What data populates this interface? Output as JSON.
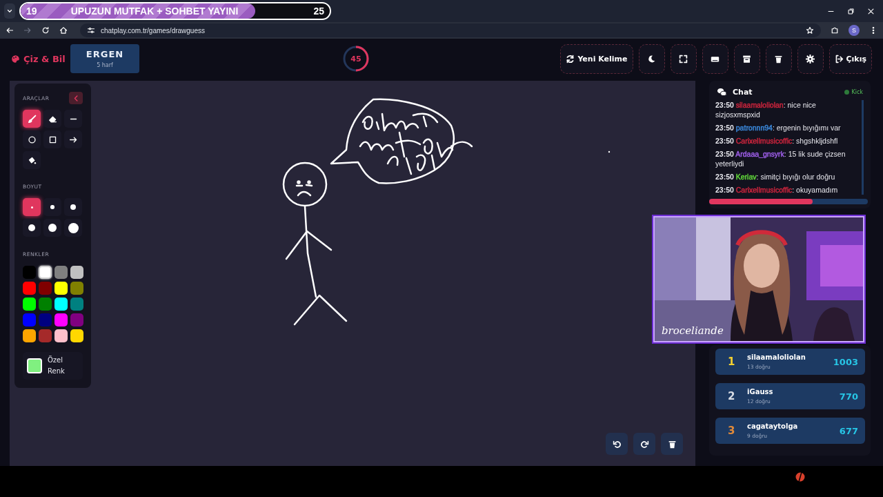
{
  "stream_goal": {
    "start": "19",
    "title": "UPUZUN MUTFAK + SOHBET YAYINI",
    "end": "25",
    "level": 0.76
  },
  "browser": {
    "url": "chatplay.com.tr/games/drawguess",
    "profile_initial": "S"
  },
  "header": {
    "logo": "Çiz & Bil",
    "word": "ERGEN",
    "word_hint": "5 harf",
    "timer": {
      "value": "45",
      "level": 0.5
    },
    "buttons": [
      {
        "kind": "refresh",
        "label": "Yeni Kelime"
      },
      {
        "kind": "moon"
      },
      {
        "kind": "expand"
      },
      {
        "kind": "keyboard"
      },
      {
        "kind": "archive"
      },
      {
        "kind": "trash"
      },
      {
        "kind": "gear"
      },
      {
        "kind": "logout",
        "label": "Çıkış"
      }
    ]
  },
  "tools_panel": {
    "tools_title": "ARAÇLAR",
    "tools": [
      {
        "kind": "brush",
        "selected": true
      },
      {
        "kind": "eraser",
        "selected": false
      },
      {
        "kind": "line",
        "selected": false
      },
      {
        "kind": "circle",
        "selected": false
      },
      {
        "kind": "square",
        "selected": false
      },
      {
        "kind": "arrow",
        "selected": false
      },
      {
        "kind": "fill",
        "selected": false
      }
    ],
    "size_title": "BOYUT",
    "sizes": [
      {
        "selected": true
      },
      {
        "selected": false
      },
      {
        "selected": false
      },
      {
        "selected": false
      },
      {
        "selected": false
      },
      {
        "selected": false
      }
    ],
    "colors_title": "RENKLER",
    "colors": [
      {
        "color": "#000000",
        "selected": false
      },
      {
        "color": "#ffffff",
        "selected": true
      },
      {
        "color": "#808080",
        "selected": false
      },
      {
        "color": "#c0c0c0",
        "selected": false
      },
      {
        "color": "#ff0000",
        "selected": false
      },
      {
        "color": "#800000",
        "selected": false
      },
      {
        "color": "#ffff00",
        "selected": false
      },
      {
        "color": "#808000",
        "selected": false
      },
      {
        "color": "#00ff00",
        "selected": false
      },
      {
        "color": "#008000",
        "selected": false
      },
      {
        "color": "#00ffff",
        "selected": false
      },
      {
        "color": "#008080",
        "selected": false
      },
      {
        "color": "#0000ff",
        "selected": false
      },
      {
        "color": "#000080",
        "selected": false
      },
      {
        "color": "#ff00ff",
        "selected": false
      },
      {
        "color": "#800080",
        "selected": false
      },
      {
        "color": "#ffa500",
        "selected": false
      },
      {
        "color": "#a52a2a",
        "selected": false
      },
      {
        "color": "#ffc0cb",
        "selected": false
      },
      {
        "color": "#ffd700",
        "selected": false
      }
    ],
    "custom_color": {
      "label": "Özel Renk",
      "color": "#80f080"
    }
  },
  "canvas_controls": [
    {
      "kind": "undo"
    },
    {
      "kind": "redo"
    },
    {
      "kind": "trash"
    }
  ],
  "chat": {
    "title": "Chat",
    "platform": "Kick",
    "messages": [
      {
        "time": "23:50",
        "user": "silaamaloliolan",
        "color": "#c8243c",
        "text": ": nice nice sizjosxmspxid"
      },
      {
        "time": "23:50",
        "user": "patronnn94",
        "color": "#3a86d8",
        "text": ": ergenin bıyığımı var"
      },
      {
        "time": "23:50",
        "user": "Carixellmusicoffic",
        "color": "#c8243c",
        "text": ": shgshkljdshfl"
      },
      {
        "time": "23:50",
        "user": "Ardaaa_gnsyrk",
        "color": "#9b5de5",
        "text": ": 15 lik sude çizsen yeterliydi"
      },
      {
        "time": "23:50",
        "user": "Keriav",
        "color": "#5fd33a",
        "text": ": simitçi bıyığı olur doğru"
      },
      {
        "time": "23:50",
        "user": "Carixellmusicoffic",
        "color": "#c8243c",
        "text": ": okuyamadım"
      }
    ]
  },
  "webcam": {
    "kind": "picture",
    "caption": "broceliande"
  },
  "leaderboard": [
    {
      "rank": "1",
      "color": "#f5d130",
      "name": "silaamaloliolan",
      "correct": "13 doğru",
      "score": "1003"
    },
    {
      "rank": "2",
      "color": "#d8dce4",
      "name": "iGauss",
      "correct": "12 doğru",
      "score": "770"
    },
    {
      "rank": "3",
      "color": "#e08a3a",
      "name": "cagataytolga",
      "correct": "9 doğru",
      "score": "677"
    }
  ]
}
